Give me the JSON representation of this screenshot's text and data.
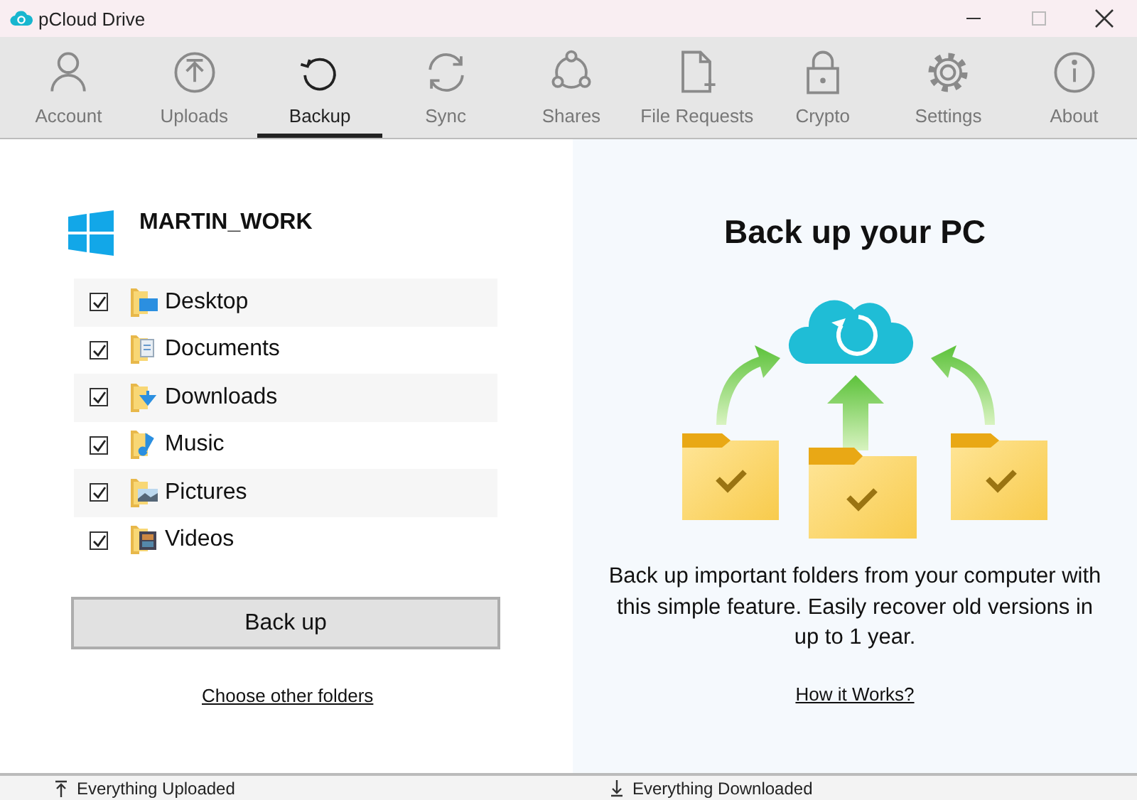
{
  "window": {
    "title": "pCloud Drive"
  },
  "tabs": [
    {
      "label": "Account",
      "selected": false
    },
    {
      "label": "Uploads",
      "selected": false
    },
    {
      "label": "Backup",
      "selected": true
    },
    {
      "label": "Sync",
      "selected": false
    },
    {
      "label": "Shares",
      "selected": false
    },
    {
      "label": "File Requests",
      "selected": false
    },
    {
      "label": "Crypto",
      "selected": false
    },
    {
      "label": "Settings",
      "selected": false
    },
    {
      "label": "About",
      "selected": false
    }
  ],
  "backup": {
    "computer": "MARTIN_WORK",
    "folders": [
      {
        "name": "Desktop",
        "checked": true
      },
      {
        "name": "Documents",
        "checked": true
      },
      {
        "name": "Downloads",
        "checked": true
      },
      {
        "name": "Music",
        "checked": true
      },
      {
        "name": "Pictures",
        "checked": true
      },
      {
        "name": "Videos",
        "checked": true
      }
    ],
    "button": "Back up",
    "link": "Choose other folders"
  },
  "promo": {
    "title": "Back up your PC",
    "description": "Back up important folders from your computer with this simple feature. Easily recover old versions in up to 1 year.",
    "link": "How it Works?"
  },
  "status_bar": {
    "upload": "Everything Uploaded",
    "download": "Everything Downloaded"
  }
}
